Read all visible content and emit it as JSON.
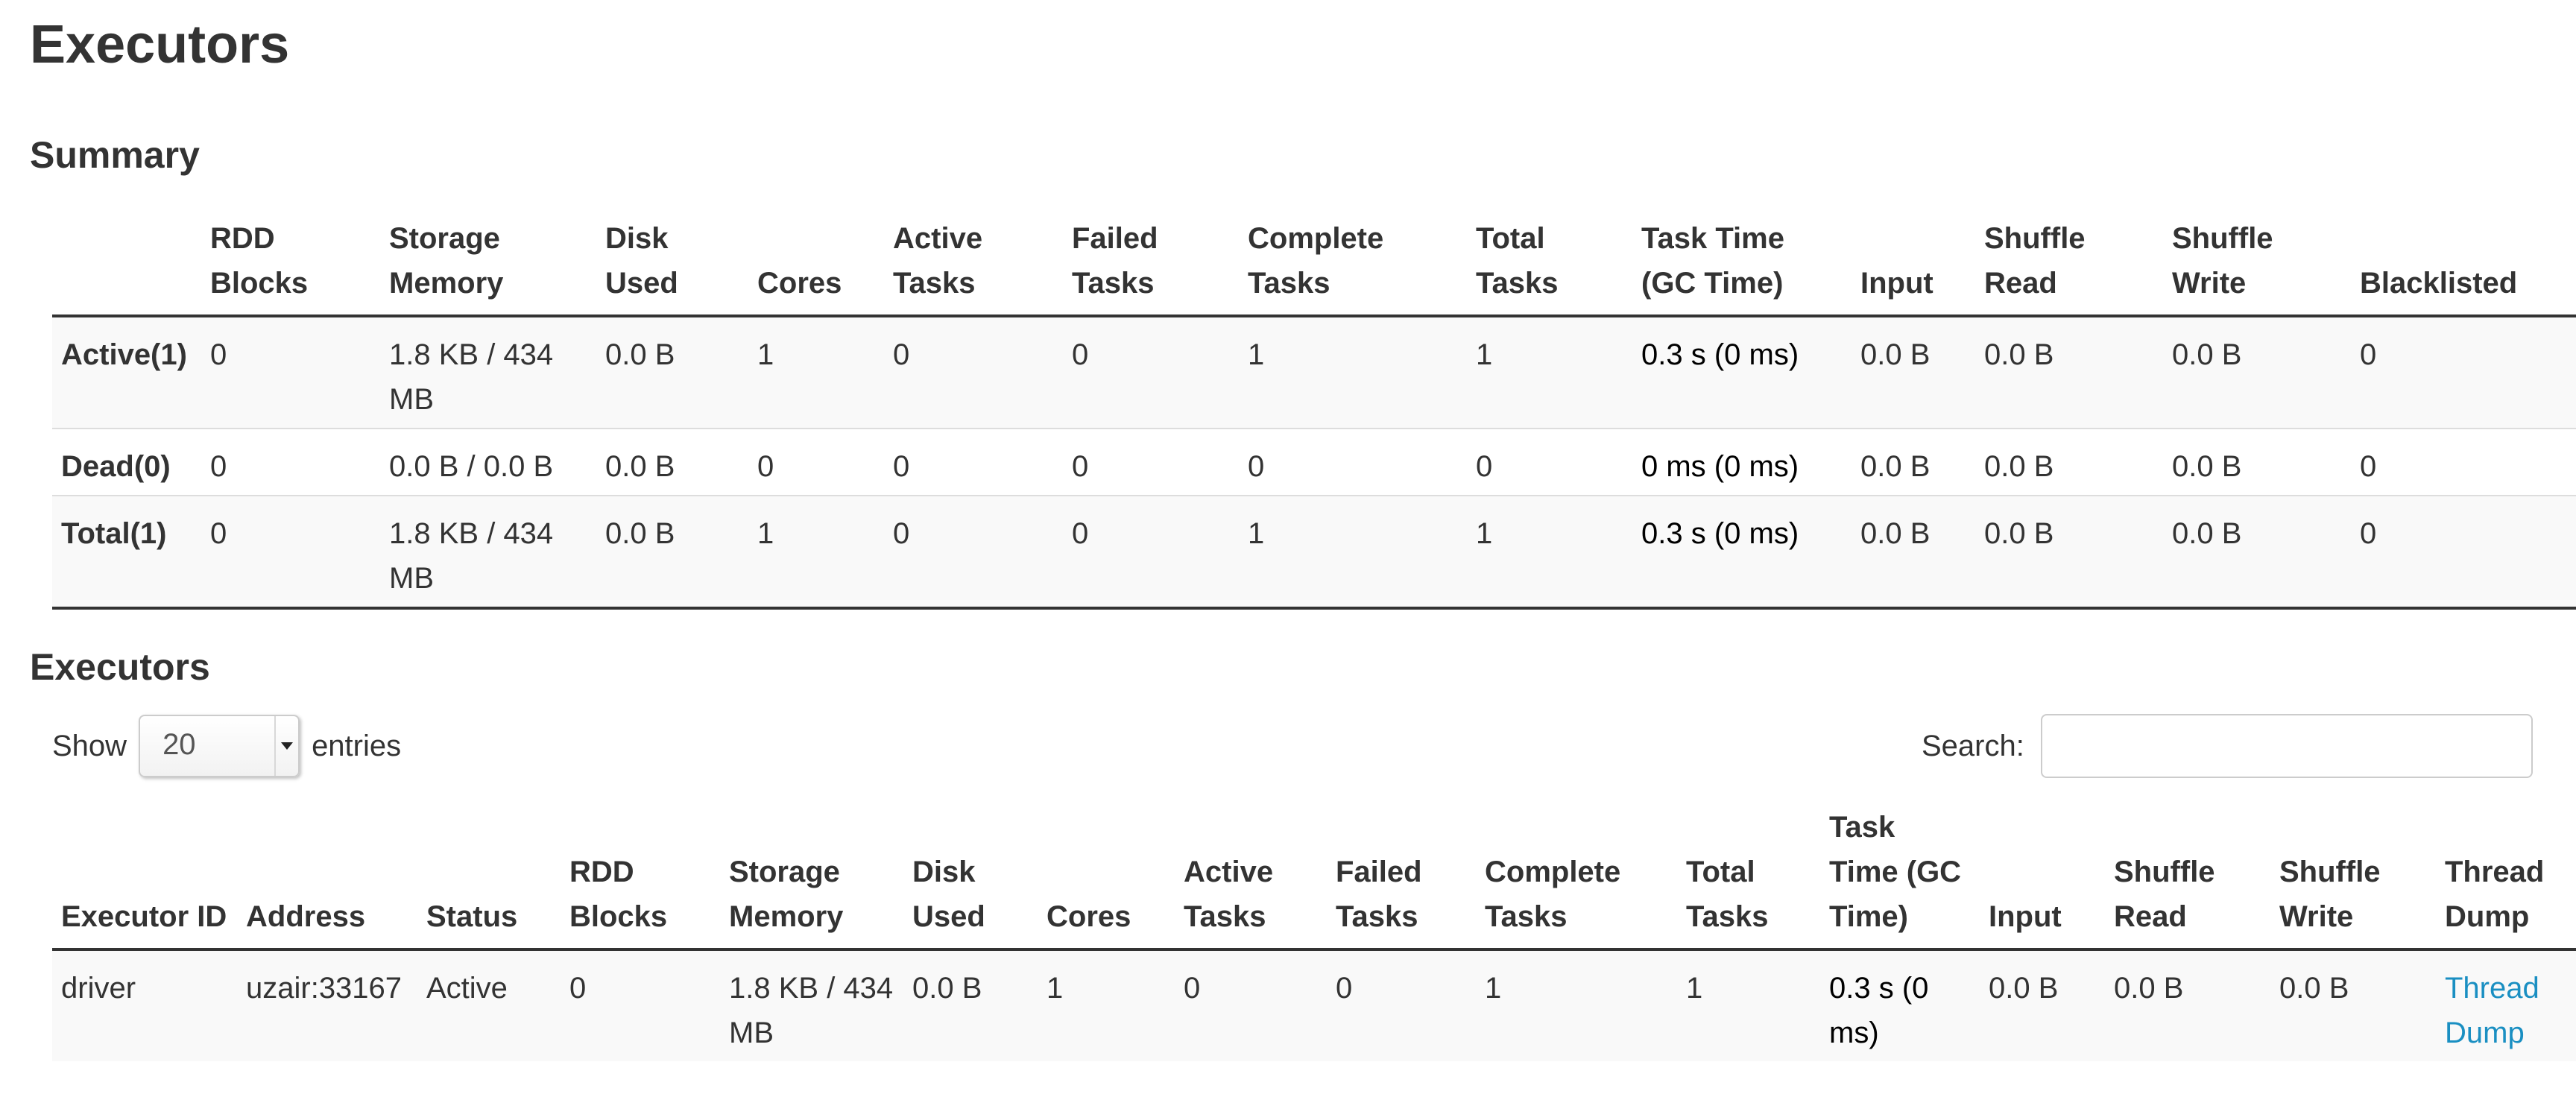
{
  "page": {
    "title": "Executors"
  },
  "summary": {
    "heading": "Summary",
    "columns": [
      [
        "",
        ""
      ],
      [
        "RDD",
        "Blocks"
      ],
      [
        "Storage",
        "Memory"
      ],
      [
        "Disk",
        "Used"
      ],
      [
        "",
        "Cores"
      ],
      [
        "Active",
        "Tasks"
      ],
      [
        "Failed",
        "Tasks"
      ],
      [
        "Complete",
        "Tasks"
      ],
      [
        "Total",
        "Tasks"
      ],
      [
        "Task Time",
        "(GC Time)"
      ],
      [
        "",
        "Input"
      ],
      [
        "Shuffle",
        "Read"
      ],
      [
        "Shuffle",
        "Write"
      ],
      [
        "",
        "Blacklisted"
      ]
    ],
    "rows": [
      [
        "Active(1)",
        "0",
        "1.8 KB / 434 MB",
        "0.0 B",
        "1",
        "0",
        "0",
        "1",
        "1",
        "0.3 s (0 ms)",
        "0.0 B",
        "0.0 B",
        "0.0 B",
        "0"
      ],
      [
        "Dead(0)",
        "0",
        "0.0 B / 0.0 B",
        "0.0 B",
        "0",
        "0",
        "0",
        "0",
        "0",
        "0 ms (0 ms)",
        "0.0 B",
        "0.0 B",
        "0.0 B",
        "0"
      ],
      [
        "Total(1)",
        "0",
        "1.8 KB / 434 MB",
        "0.0 B",
        "1",
        "0",
        "0",
        "1",
        "1",
        "0.3 s (0 ms)",
        "0.0 B",
        "0.0 B",
        "0.0 B",
        "0"
      ]
    ]
  },
  "executors": {
    "heading": "Executors",
    "show_label": "Show",
    "entries_value": "20",
    "entries_label": "entries",
    "search_label": "Search:",
    "search_value": "",
    "columns": [
      "Executor ID",
      "Address",
      "Status",
      "RDD Blocks",
      "Storage Memory",
      "Disk Used",
      "Cores",
      "Active Tasks",
      "Failed Tasks",
      "Complete Tasks",
      "Total Tasks",
      "Task Time (GC Time)",
      "Input",
      "Shuffle Read",
      "Shuffle Write",
      "Thread Dump"
    ],
    "rows": [
      [
        "driver",
        "uzair:33167",
        "Active",
        "0",
        "1.8 KB / 434 MB",
        "0.0 B",
        "1",
        "0",
        "0",
        "1",
        "1",
        "0.3 s (0 ms)",
        "0.0 B",
        "0.0 B",
        "0.0 B",
        "Thread Dump"
      ]
    ]
  },
  "colors": {
    "link": "#1a8fc2",
    "stripe": "#f9f9f9",
    "border": "#333333"
  }
}
